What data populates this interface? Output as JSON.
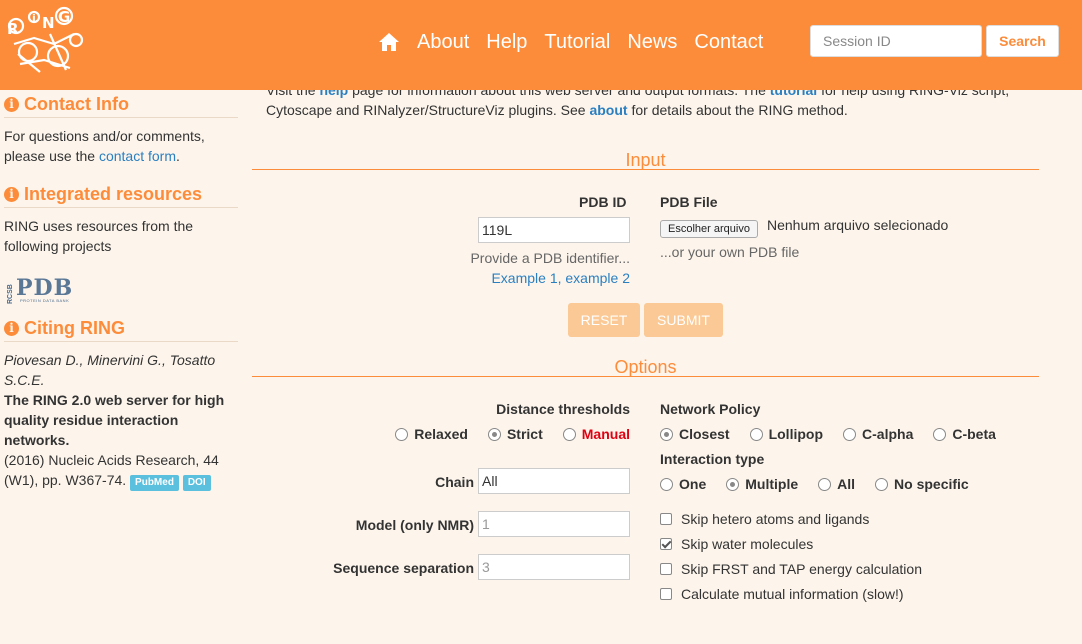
{
  "navbar": {
    "logo_text": "RiNG",
    "links": [
      "About",
      "Help",
      "Tutorial",
      "News",
      "Contact"
    ],
    "session_placeholder": "Session ID",
    "search_label": "Search"
  },
  "sidebar": {
    "contact": {
      "title": "Contact Info",
      "text_before": "For questions and/or comments, please use the ",
      "link": "contact form",
      "text_after": "."
    },
    "resources": {
      "title": "Integrated resources",
      "text": "RING uses resources from the following projects",
      "pdb_logo_text": "PDB",
      "pdb_logo_small": "RCSB",
      "pdb_logo_sub": "PROTEIN DATA BANK"
    },
    "citing": {
      "title": "Citing RING",
      "authors": "Piovesan D., Minervini G., Tosatto S.C.E.",
      "paper_title": "The RING 2.0 web server for high quality residue interaction networks.",
      "reference": "(2016) Nucleic Acids Research, 44 (W1), pp. W367-74.",
      "pubmed": "PubMed",
      "doi": "DOI"
    }
  },
  "intro": {
    "t1": "Visit the ",
    "help": "help",
    "t2": " page for information about this web server and output formats. The ",
    "tutorial": "tutorial",
    "t3": " for help using RING-Viz script, Cytoscape and RINalyzer/StructureViz plugins. See ",
    "about": "about",
    "t4": " for details about the RING method."
  },
  "input": {
    "title": "Input",
    "pdb_id_label": "PDB ID",
    "pdb_id_value": "119L",
    "pdb_id_hint": "Provide a PDB identifier...",
    "example_link": "Example 1, example 2",
    "pdb_file_label": "PDB File",
    "file_button": "Escolher arquivo",
    "file_status": "Nenhum arquivo selecionado",
    "file_hint": "...or your own PDB file",
    "reset": "RESET",
    "submit": "SUBMIT"
  },
  "options": {
    "title": "Options",
    "distance_label": "Distance thresholds",
    "distance_opts": [
      "Relaxed",
      "Strict",
      "Manual"
    ],
    "chain_label": "Chain",
    "chain_value": "All",
    "model_label": "Model (only NMR)",
    "model_value": "1",
    "seq_label": "Sequence separation",
    "seq_value": "3",
    "network_label": "Network Policy",
    "network_opts": [
      "Closest",
      "Lollipop",
      "C-alpha",
      "C-beta"
    ],
    "interaction_label": "Interaction type",
    "interaction_opts": [
      "One",
      "Multiple",
      "All",
      "No specific"
    ],
    "checks": [
      "Skip hetero atoms and ligands",
      "Skip water molecules",
      "Skip FRST and TAP energy calculation",
      "Calculate mutual information (slow!)"
    ],
    "manual_color": "#e00012"
  }
}
